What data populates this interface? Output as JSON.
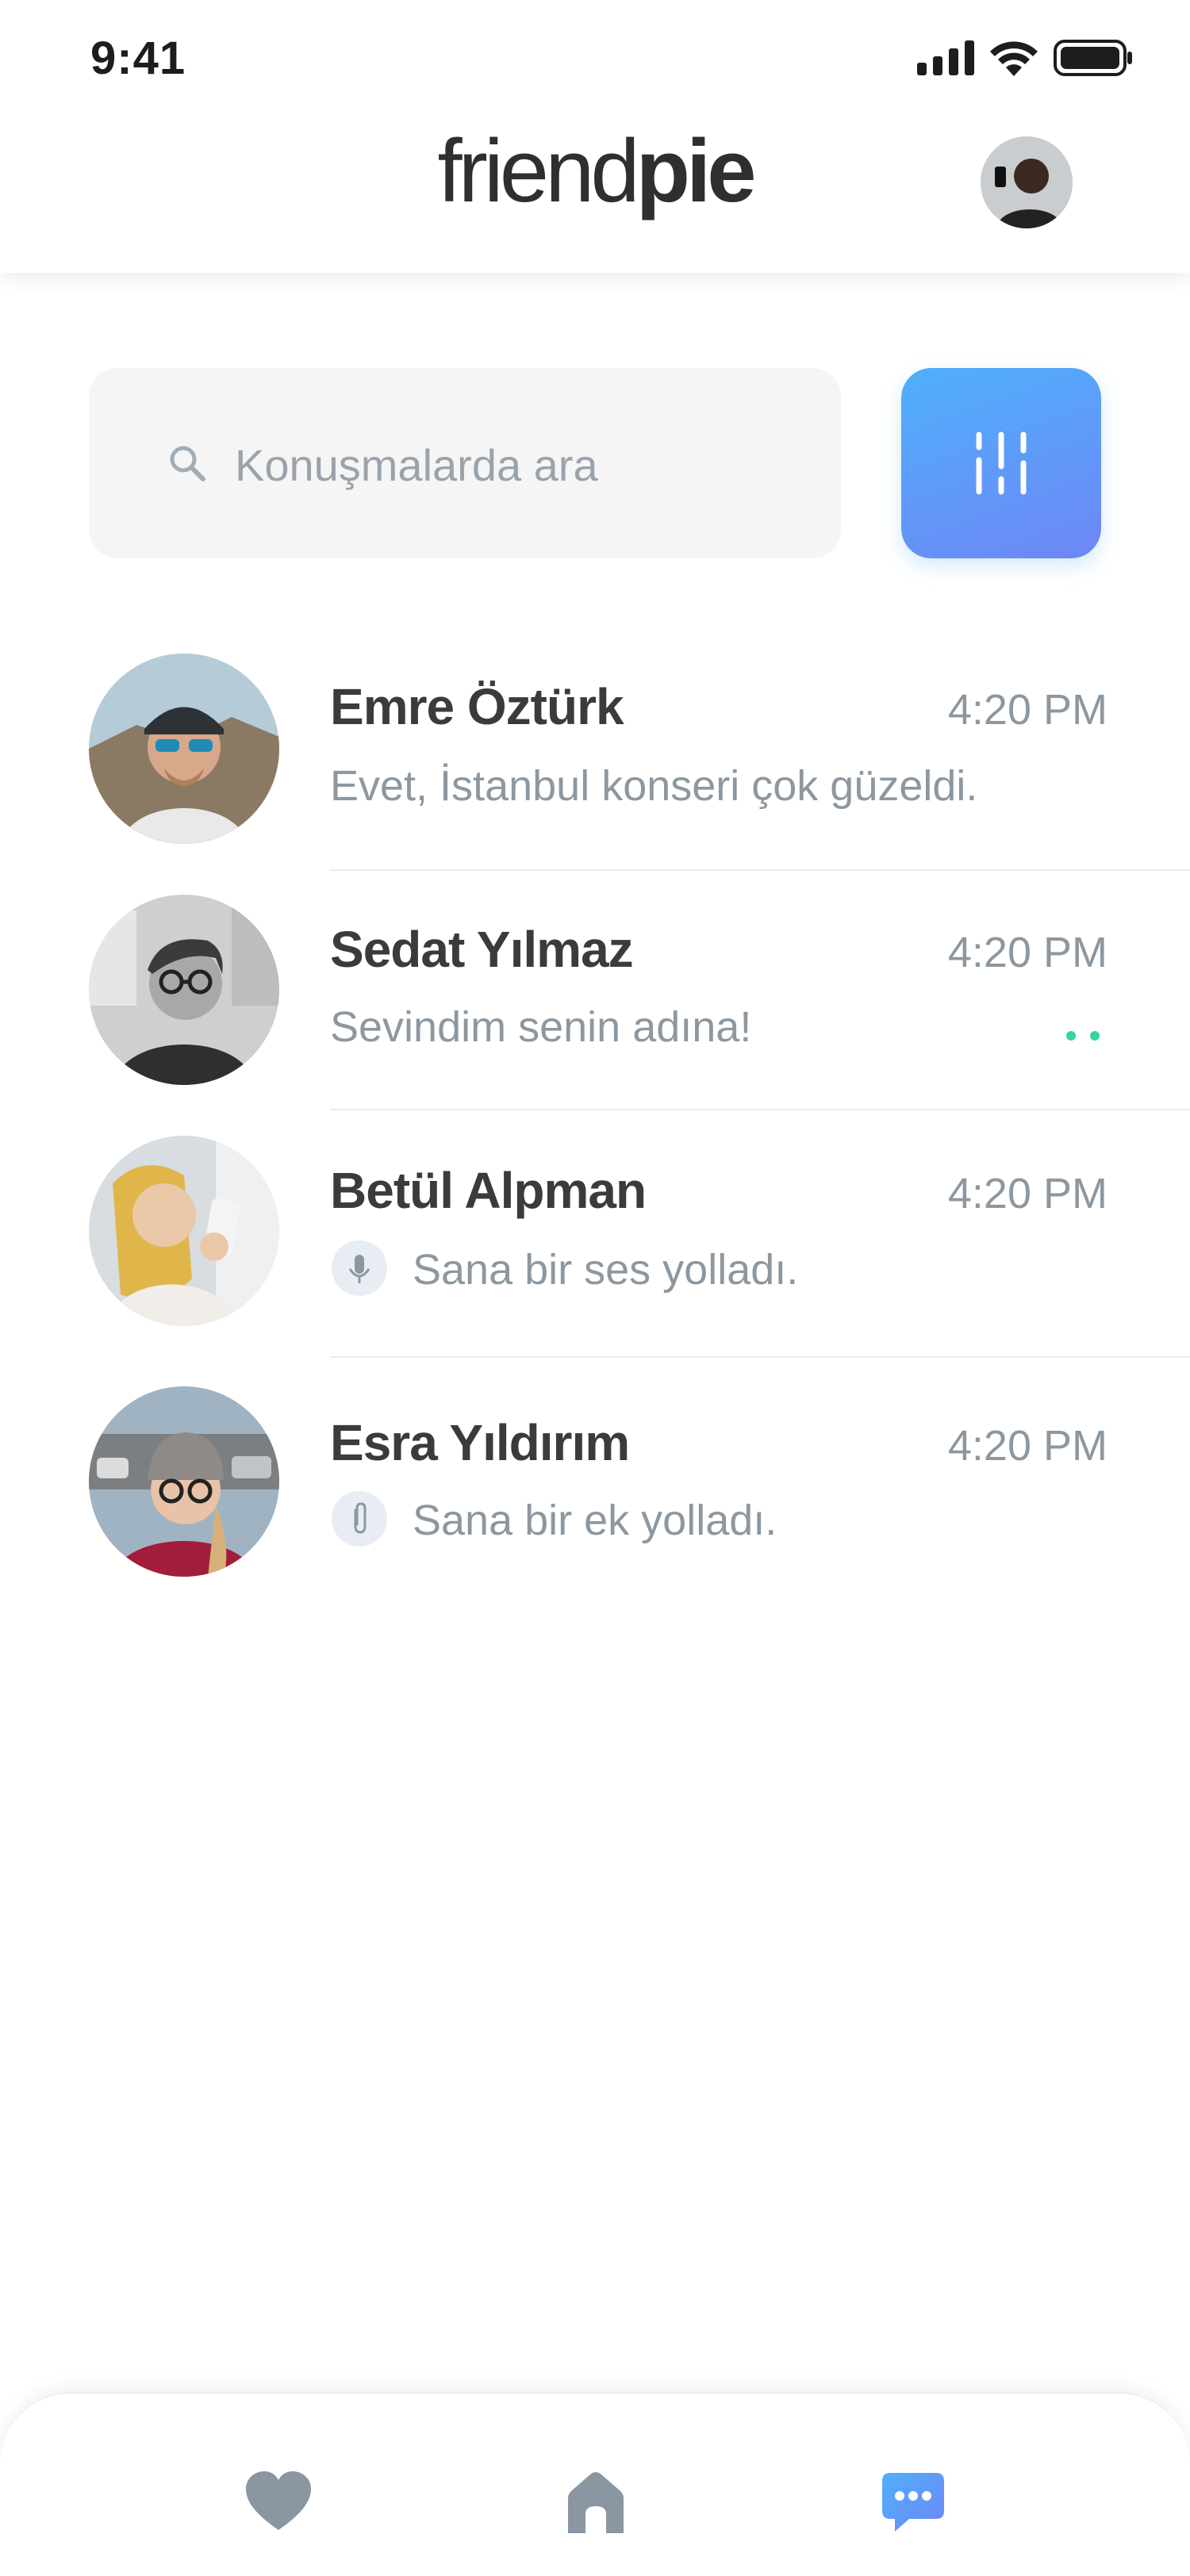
{
  "status_bar": {
    "time": "9:41"
  },
  "header": {
    "brand_part1": "friend",
    "brand_part2": "pie"
  },
  "search": {
    "placeholder": "Konuşmalarda ara"
  },
  "conversations": [
    {
      "name": "Emre Öztürk",
      "time": "4:20 PM",
      "message": "Evet, İstanbul konseri çok güzeldi.",
      "type": "text"
    },
    {
      "name": "Sedat Yılmaz",
      "time": "4:20 PM",
      "message": "Sevindim senin adına!",
      "type": "text",
      "unread": true
    },
    {
      "name": "Betül Alpman",
      "time": "4:20 PM",
      "message": "Sana bir ses yolladı.",
      "type": "voice",
      "icon": "microphone-icon"
    },
    {
      "name": "Esra Yıldırım",
      "time": "4:20 PM",
      "message": "Sana bir ek yolladı.",
      "type": "attachment",
      "icon": "paperclip-icon"
    }
  ],
  "bottom_nav": {
    "items": [
      {
        "icon": "heart-icon",
        "active": false
      },
      {
        "icon": "home-icon",
        "active": false
      },
      {
        "icon": "chat-icon",
        "active": true
      }
    ],
    "active_color": "#5b8cf5",
    "inactive_color": "#8a97a2"
  },
  "colors": {
    "accent_gradient_start": "#4fb0fb",
    "accent_gradient_end": "#6e86f6",
    "unread_dot": "#34d4a0"
  }
}
